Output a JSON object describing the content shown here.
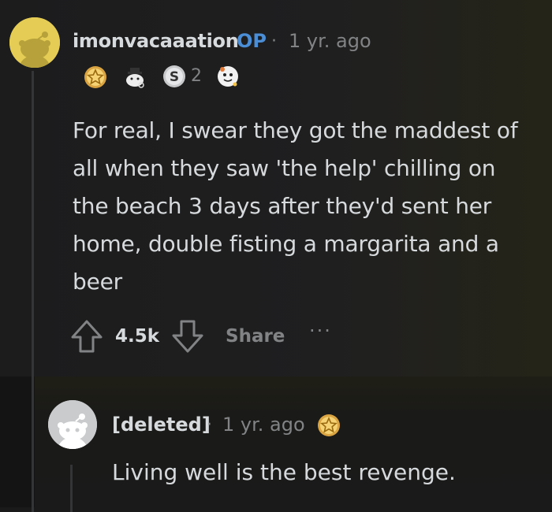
{
  "comment": {
    "username": "imonvacaaation",
    "op_badge": "OP",
    "separator": "·",
    "time": "1 yr. ago",
    "award_count": "2",
    "awards": [
      "gold-star-award-icon",
      "cat-detective-award-icon",
      "silver-s-award-icon",
      "wholesome-seal-award-icon"
    ],
    "body": "For real, I swear they got the maddest of all when they saw 'the help' chilling on the beach 3 days after they'd sent her home, double fisting a margarita and a beer",
    "score": "4.5k",
    "share_label": "Share",
    "more_label": "···"
  },
  "reply": {
    "username": "[deleted]",
    "separator": "·",
    "time": "1 yr. ago",
    "awards": [
      "gold-star-award-icon"
    ],
    "body": "Living well is the best revenge."
  },
  "colors": {
    "background": "#1a1a1b",
    "text": "#d7dadc",
    "meta": "#818384",
    "op_blue": "#4b8ed6",
    "avatar_op": "#e4cc55"
  }
}
